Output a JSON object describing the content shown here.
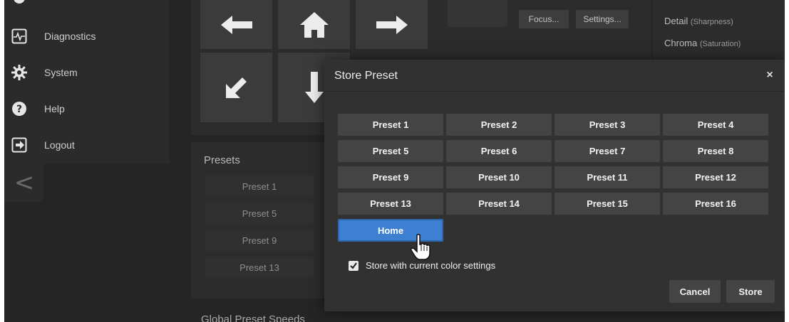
{
  "sidebar": {
    "items": [
      {
        "label": "Diagnostics",
        "icon": "pulse-icon"
      },
      {
        "label": "System",
        "icon": "gear-icon"
      },
      {
        "label": "Help",
        "icon": "help-icon"
      },
      {
        "label": "Logout",
        "icon": "logout-icon"
      }
    ],
    "collapse": "<"
  },
  "camera": {
    "focus_label": "Focus...",
    "settings_label": "Settings...",
    "detail_label": "Detail",
    "detail_hint": "(Sharpness)",
    "chroma_label": "Chroma",
    "chroma_hint": "(Saturation)"
  },
  "presets_section": {
    "title": "Presets",
    "items": [
      "Preset 1",
      "Preset 5",
      "Preset 9",
      "Preset 13"
    ],
    "next_title": "Global Preset Speeds"
  },
  "modal": {
    "title": "Store Preset",
    "close": "×",
    "presets": [
      "Preset 1",
      "Preset 2",
      "Preset 3",
      "Preset 4",
      "Preset 5",
      "Preset 6",
      "Preset 7",
      "Preset 8",
      "Preset 9",
      "Preset 10",
      "Preset 11",
      "Preset 12",
      "Preset 13",
      "Preset 14",
      "Preset 15",
      "Preset 16"
    ],
    "home_label": "Home",
    "checkbox_label": "Store with current color settings",
    "checkbox_checked": true,
    "cancel_label": "Cancel",
    "store_label": "Store"
  },
  "colors": {
    "accent": "#3d7fd0",
    "background": "#252525",
    "button": "#444444"
  }
}
